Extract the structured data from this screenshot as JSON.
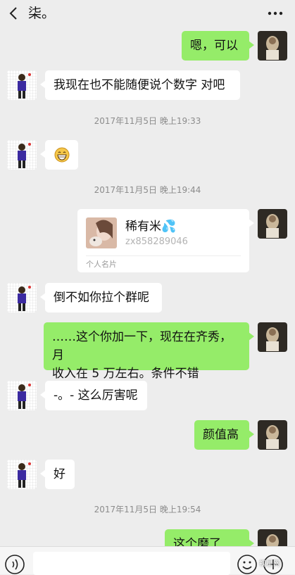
{
  "header": {
    "title": "柒。",
    "back_icon": "chevron-left-icon",
    "more_icon": "ellipsis-icon"
  },
  "messages": [
    {
      "side": "right",
      "text": "嗯，可以"
    },
    {
      "side": "left",
      "text": "我现在也不能随便说个数字 对吧"
    },
    {
      "timestamp": "2017年11月5日 晚上19:33"
    },
    {
      "side": "left",
      "emoji": "grinning-face-emoji"
    },
    {
      "timestamp": "2017年11月5日 晚上19:44"
    },
    {
      "side": "right",
      "card": {
        "name": "稀有米💦",
        "wechat_id": "zx858289046",
        "type_label": "个人名片"
      }
    },
    {
      "side": "left",
      "text": "倒不如你拉个群呢"
    },
    {
      "side": "right",
      "text_line1": "……这个你加一下，现在在齐秀，月",
      "text_line2": "收入在 5 万左右。条件不错"
    },
    {
      "side": "left",
      "text": "-。- 这么厉害呢"
    },
    {
      "side": "right",
      "text": "颜值高"
    },
    {
      "side": "left",
      "text": "好"
    },
    {
      "timestamp": "2017年11月5日 晚上19:54"
    },
    {
      "side": "right",
      "text": "这个磨了"
    }
  ],
  "bottom_bar": {
    "voice_icon": "voice-icon",
    "emoji_icon": "emoji-icon",
    "plus_icon": "plus-icon"
  },
  "watermark": "视星网",
  "colors": {
    "background": "#ededed",
    "self_bubble": "#95ec69",
    "other_bubble": "#ffffff"
  }
}
